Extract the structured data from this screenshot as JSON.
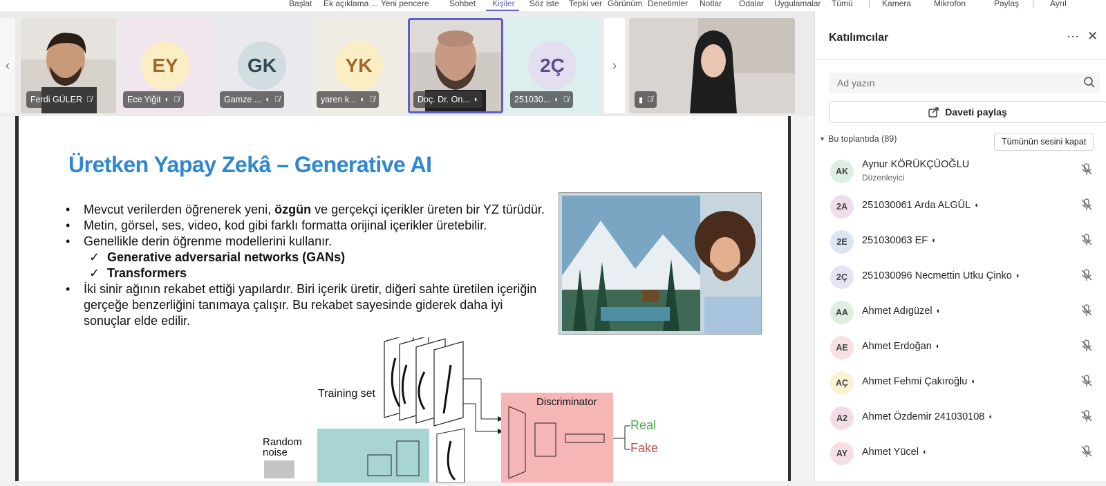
{
  "toolbar": {
    "items": [
      {
        "label": "Başlat"
      },
      {
        "label": "Ek açıklama ..."
      },
      {
        "label": "Yeni pencere"
      },
      {
        "label": "Sohbet"
      },
      {
        "label": "Kişiler"
      },
      {
        "label": "Söz iste"
      },
      {
        "label": "Tepki ver"
      },
      {
        "label": "Görünüm"
      },
      {
        "label": "Denetimler"
      },
      {
        "label": "Notlar"
      },
      {
        "label": "Odalar"
      },
      {
        "label": "Uygulamalar"
      },
      {
        "label": "Tümü"
      },
      {
        "label": "Kamera"
      },
      {
        "label": "Mikrofon"
      },
      {
        "label": "Paylaş"
      },
      {
        "label": "Ayrıl"
      }
    ],
    "active": "Kişiler"
  },
  "gallery": {
    "tiles": [
      {
        "name": "Ferdi GÜLER",
        "initials": "",
        "video": true
      },
      {
        "name": "Ece Yiğit",
        "initials": "EY",
        "bg": "#f1e6ee",
        "circle": "#fbeec4",
        "fg": "#a0662a"
      },
      {
        "name": "Gamze ...",
        "initials": "GK",
        "bg": "#e9e9ee",
        "circle": "#d2dde1",
        "fg": "#2f4a55"
      },
      {
        "name": "yaren k...",
        "initials": "YK",
        "bg": "#efece3",
        "circle": "#fbeec4",
        "fg": "#a0662a"
      },
      {
        "name": "Doç. Dr. On...",
        "initials": "",
        "video": true
      },
      {
        "name": "251030...",
        "initials": "2Ç",
        "bg": "#dcefee",
        "circle": "#e4def1",
        "fg": "#5d4c8a"
      },
      {
        "name": "",
        "initials": "",
        "video": true
      }
    ]
  },
  "slide": {
    "title": "Üretken Yapay Zekâ – Generative AI",
    "b1_pre": "Mevcut verilerden öğrenerek yeni, ",
    "b1_bold": "özgün",
    "b1_post": " ve gerçekçi içerikler üreten bir YZ türüdür.",
    "b2": "Metin, görsel, ses, video, kod gibi farklı formatta orijinal içerikler üretebilir.",
    "b3": "Genellikle derin öğrenme modellerini kullanır.",
    "s1": "Generative adversarial networks (GANs)",
    "s2": "Transformers",
    "b4": "İki sinir ağının rekabet ettiği yapılardır. Biri içerik üretir, diğeri sahte üretilen içeriğin gerçeğe benzerliğini tanımaya çalışır. Bu rekabet sayesinde giderek daha iyi sonuçlar elde edilir.",
    "diagram": {
      "training_set": "Training set",
      "random": "Random",
      "noise": "noise",
      "discriminator": "Discriminator",
      "real": "Real",
      "fake": "Fake"
    }
  },
  "panel": {
    "title": "Katılımcılar",
    "search_placeholder": "Ad yazın",
    "invite_label": "Daveti paylaş",
    "group_label": "Bu toplantıda (89)",
    "mute_all_label": "Tümünün sesini kapat",
    "participants": [
      {
        "initials": "AK",
        "name": "Aynur KÖRÜKÇÜOĞLU",
        "role": "Düzenleyici",
        "color": "#dcefe0"
      },
      {
        "initials": "2A",
        "name": "251030061 Arda ALGÜL",
        "color": "#f0dde9"
      },
      {
        "initials": "2E",
        "name": "251030063 EF",
        "color": "#dde4f4"
      },
      {
        "initials": "2Ç",
        "name": "251030096 Necmettin Utku Çinko",
        "color": "#e6e1f3"
      },
      {
        "initials": "AA",
        "name": "Ahmet Adıgüzel",
        "color": "#e0eee2"
      },
      {
        "initials": "AE",
        "name": "Ahmet Erdoğan",
        "color": "#f7e1e1"
      },
      {
        "initials": "AÇ",
        "name": "Ahmet Fehmi Çakıroğlu",
        "color": "#fbf1d3"
      },
      {
        "initials": "A2",
        "name": "Ahmet Özdemir 241030108",
        "color": "#f2dde7"
      },
      {
        "initials": "AY",
        "name": "Ahmet Yücel",
        "color": "#f6dfe3"
      }
    ]
  },
  "colors": {
    "accent": "#5b5fc7",
    "title_blue": "#2f86d1",
    "disc_bg": "#f7b6b6",
    "gen_bg": "#a9d4d4"
  }
}
